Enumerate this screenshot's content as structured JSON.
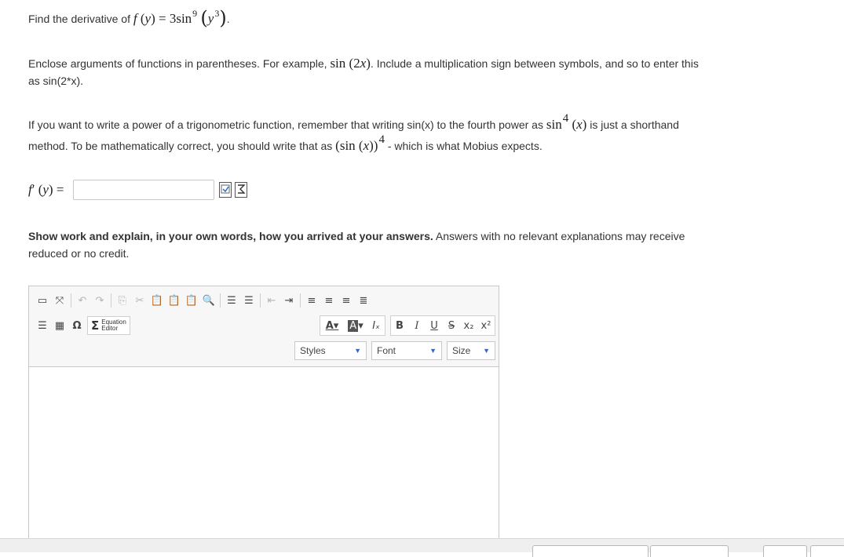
{
  "question": {
    "intro": "Find the derivative of",
    "func_name": "f",
    "func_var": "y",
    "func_equals": "= 3",
    "func_sin": "sin",
    "func_power": "9",
    "func_inner_var": "y",
    "func_inner_power": "3",
    "period": "."
  },
  "instruction1": {
    "text_a": "Enclose arguments of functions in parentheses. For example,",
    "example_fn": "sin",
    "example_arg": "2",
    "example_var": "x",
    "text_b": ". Include a multiplication sign between symbols, and so to enter this as sin(2*x)."
  },
  "instruction2": {
    "text_a": "If you want to write a power of a trigonometric function, remember that writing sin(x) to the fourth power as",
    "ex1_fn": "sin",
    "ex1_power": "4",
    "ex1_var": "x",
    "text_b": "is just a shorthand method. To be mathematically correct, you should write that as",
    "ex2_fn": "sin",
    "ex2_var": "x",
    "ex2_power": "4",
    "text_c": "- which is what Mobius expects."
  },
  "answer": {
    "label_fn": "f",
    "label_prime": "′",
    "label_var": "y",
    "label_equals": "=",
    "value": "",
    "icons": [
      "preview-icon",
      "equation-icon"
    ]
  },
  "explanation": {
    "bold": "Show work and explain, in your own words, how you arrived at your answers.",
    "rest": "Answers with no relevant explanations may receive reduced or no credit."
  },
  "editor": {
    "equation_editor_label_1": "Equation",
    "equation_editor_label_2": "Editor",
    "styles_label": "Styles",
    "font_label": "Font",
    "size_label": "Size",
    "body_text": ""
  }
}
